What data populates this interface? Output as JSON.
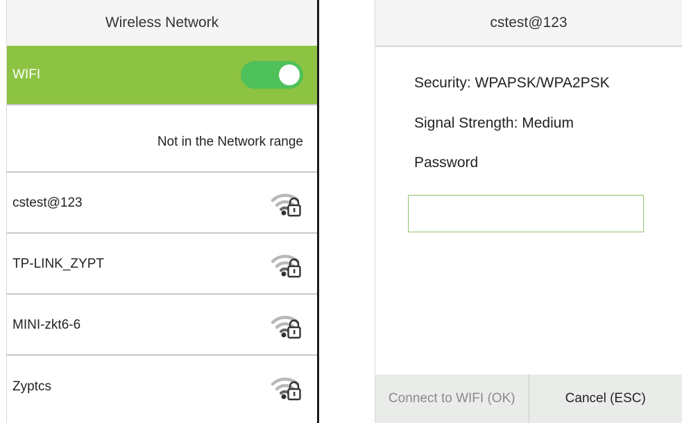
{
  "left": {
    "title": "Wireless Network",
    "wifi_label": "WIFI",
    "wifi_enabled": true,
    "status_text": "Not in the Network range",
    "networks": [
      {
        "ssid": "cstest@123",
        "icon": "wifi-lock-icon"
      },
      {
        "ssid": "TP-LINK_ZYPT",
        "icon": "wifi-lock-icon"
      },
      {
        "ssid": "MINI-zkt6-6",
        "icon": "wifi-lock-icon"
      },
      {
        "ssid": "Zyptcs",
        "icon": "wifi-lock-icon"
      }
    ]
  },
  "right": {
    "title": "cstest@123",
    "security": "Security:  WPAPSK/WPA2PSK",
    "signal": "Signal Strength:  Medium",
    "password_label": "Password",
    "password_value": "",
    "connect_label": "Connect to WIFI (OK)",
    "cancel_label": "Cancel (ESC)"
  },
  "colors": {
    "accent_green": "#8cc342",
    "toggle_green": "#4fc15a",
    "input_border": "#8ec26a"
  }
}
